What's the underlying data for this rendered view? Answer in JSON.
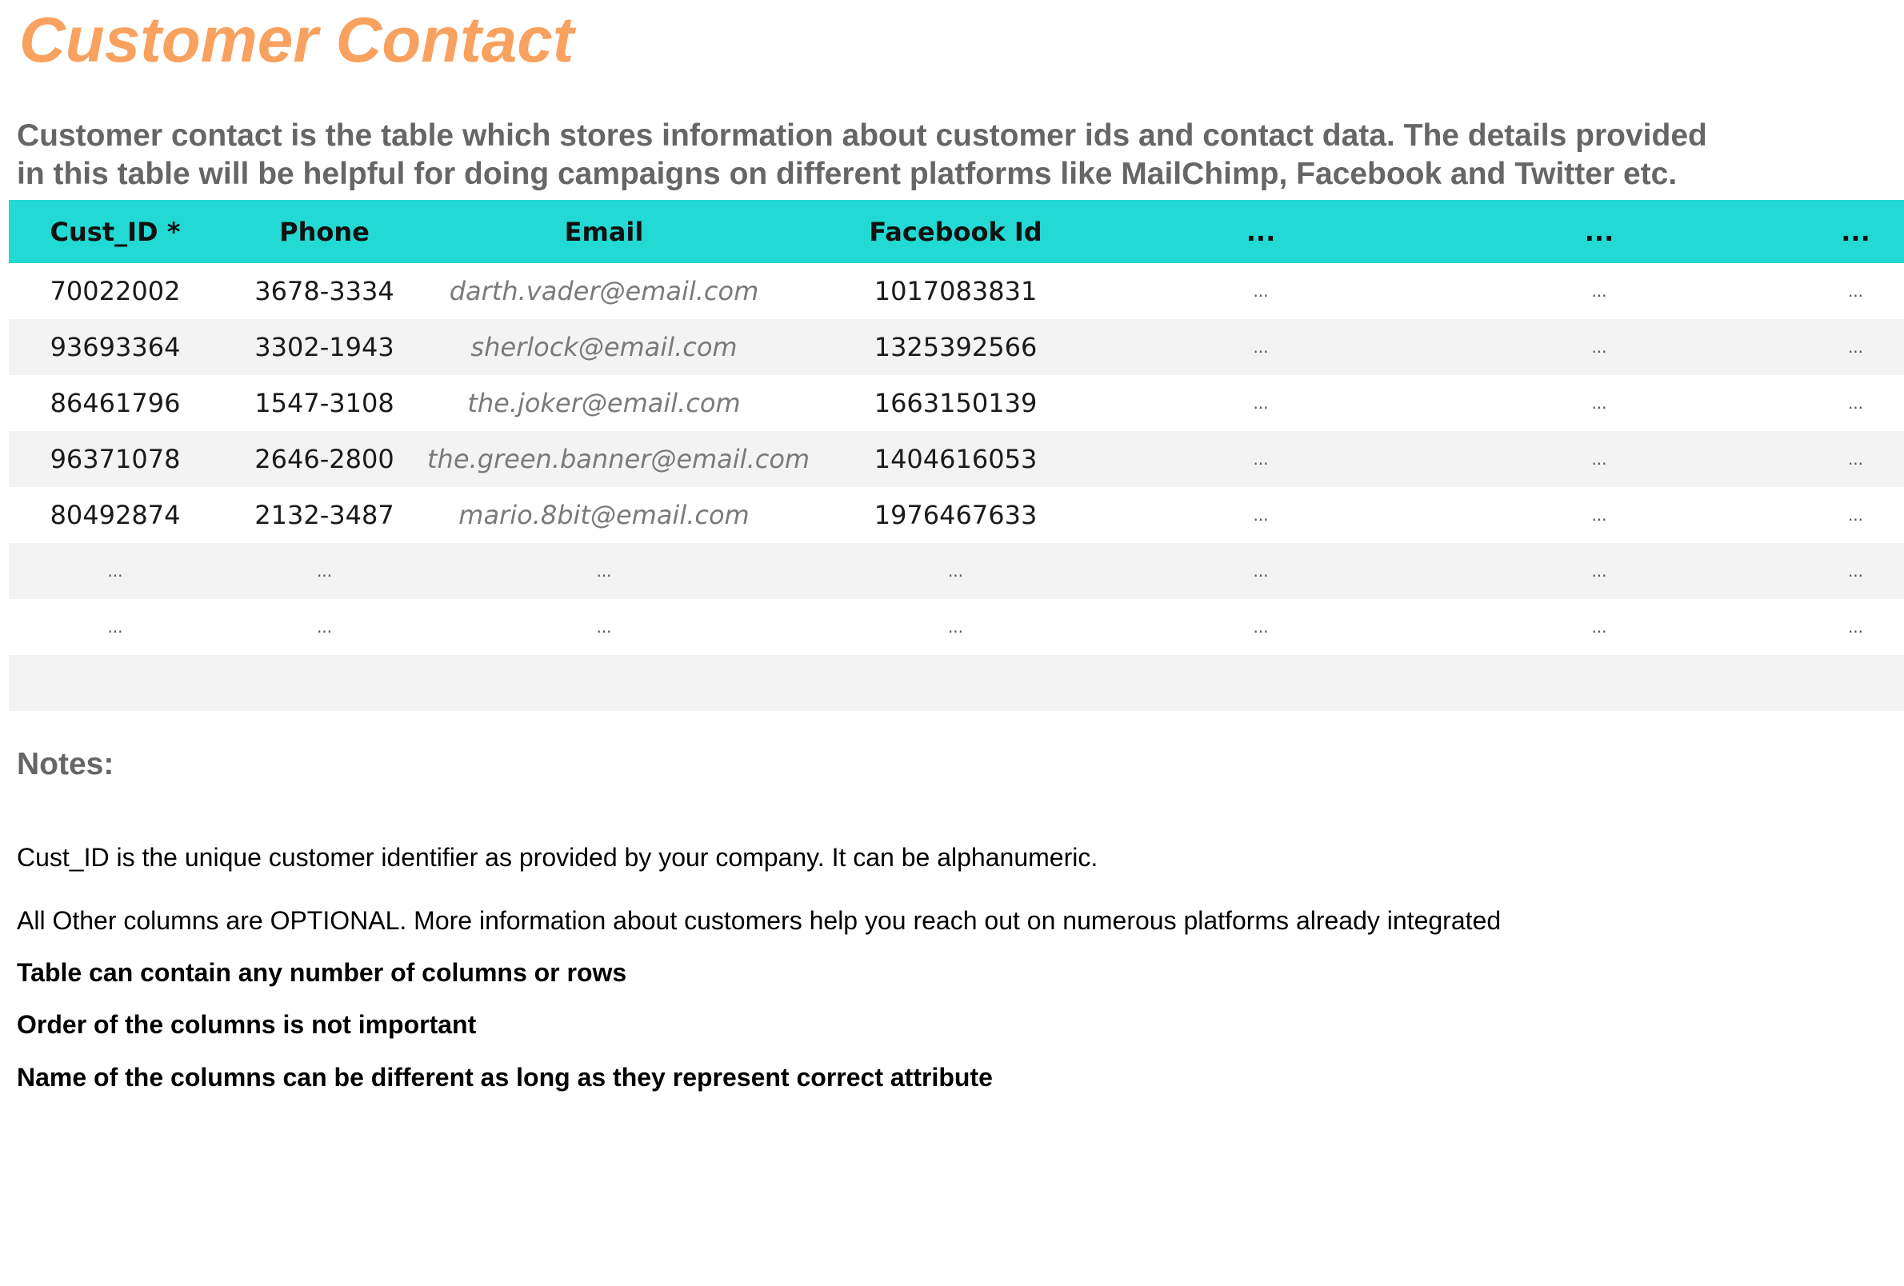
{
  "title": "Customer Contact",
  "description_lines": [
    "Customer contact is the table which stores information about customer ids and contact data. The details provided",
    "in this table will be helpful for doing campaigns on different platforms like MailChimp, Facebook and Twitter etc."
  ],
  "table": {
    "columns": [
      "Cust_ID *",
      "Phone",
      "Email",
      "Facebook Id",
      "...",
      "...",
      "..."
    ],
    "rows": [
      [
        "70022002",
        "3678-3334",
        "darth.vader@email.com",
        "1017083831",
        "...",
        "...",
        "..."
      ],
      [
        "93693364",
        "3302-1943",
        "sherlock@email.com",
        "1325392566",
        "...",
        "...",
        "..."
      ],
      [
        "86461796",
        "1547-3108",
        "the.joker@email.com",
        "1663150139",
        "...",
        "...",
        "..."
      ],
      [
        "96371078",
        "2646-2800",
        "the.green.banner@email.com",
        "1404616053",
        "...",
        "...",
        "..."
      ],
      [
        "80492874",
        "2132-3487",
        "mario.8bit@email.com",
        "1976467633",
        "...",
        "...",
        "..."
      ],
      [
        "...",
        "...",
        "...",
        "...",
        "...",
        "...",
        "..."
      ],
      [
        "...",
        "...",
        "...",
        "...",
        "...",
        "...",
        "..."
      ]
    ]
  },
  "notes": {
    "heading": "Notes:",
    "items": [
      "Cust_ID is the unique customer identifier as provided by your company. It can be alphanumeric.",
      "All Other columns are OPTIONAL. More information about customers help you reach out on numerous platforms already integrated",
      "Table can contain any number of columns or rows",
      "Order of the columns is not important",
      "Name of the columns can be different as long as they represent correct attribute"
    ]
  }
}
